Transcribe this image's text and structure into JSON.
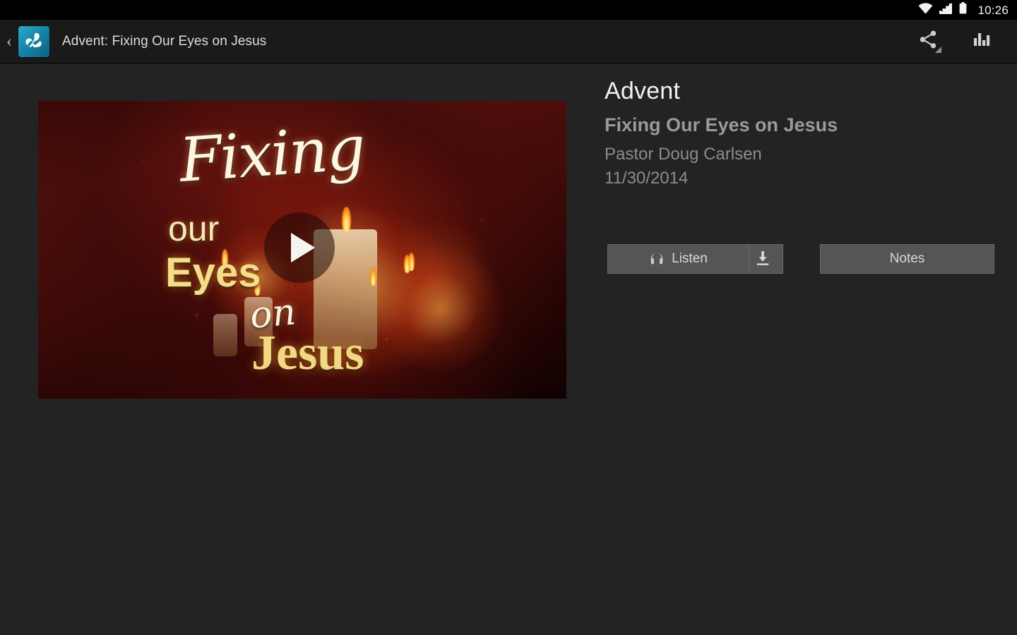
{
  "status_bar": {
    "time": "10:26",
    "icons": [
      "wifi-icon",
      "cellular-signal-icon",
      "battery-icon"
    ]
  },
  "action_bar": {
    "back_label": "‹",
    "app_icon": "butterfly-app-icon",
    "title": "Advent: Fixing Our Eyes on Jesus",
    "actions": [
      {
        "name": "share-icon",
        "label": "Share"
      },
      {
        "name": "bar-chart-icon",
        "label": "Stats"
      }
    ]
  },
  "video": {
    "play_label": "Play",
    "thumbnail_text": {
      "line1": "Fixing",
      "line2": "our",
      "line3": "Eyes",
      "line4": "on",
      "line5": "Jesus"
    }
  },
  "info": {
    "series": "Advent",
    "message_title": "Fixing Our Eyes on Jesus",
    "speaker": "Pastor Doug Carlsen",
    "date": "11/30/2014"
  },
  "buttons": {
    "listen": "Listen",
    "download": "",
    "notes": "Notes"
  },
  "colors": {
    "status_bar_bg": "#000000",
    "action_bar_bg": "#1a1a1a",
    "content_bg": "#232323",
    "button_bg": "#555555",
    "accent_icon": "#1687aa",
    "title_text": "#f1f1f1",
    "secondary_text": "#8c8c8c"
  }
}
